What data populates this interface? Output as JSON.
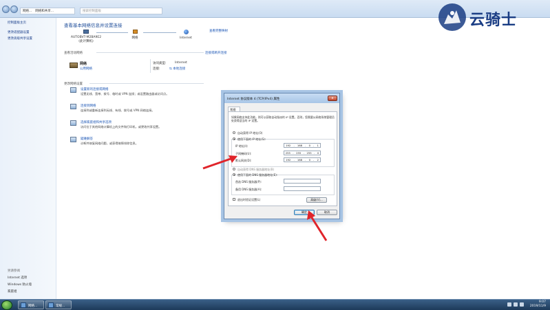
{
  "breadcrumb": [
    "网络...",
    "网络和共享..."
  ],
  "search_placeholder": "搜索控制面板",
  "left_pane": {
    "items": [
      "控制面板主页",
      "更改适配器设置",
      "更改高级共享设置"
    ],
    "see_also_head": "另请参阅",
    "see_also": [
      "Internet 选项",
      "Windows 防火墙",
      "家庭组"
    ]
  },
  "main": {
    "title": "查看基本网络信息并设置连接",
    "full_map": "查看完整映射",
    "nodes": {
      "computer": "AUTOBVT-M2BA9E2",
      "computer_sub": "(此计算机)",
      "network": "网络",
      "internet": "Internet"
    },
    "active_label": "查看活动网络",
    "connect_disconnect": "连接或断开连接",
    "network_name": "网络",
    "network_type": "公用网络",
    "access_type_label": "访问类型:",
    "access_type_value": "Internet",
    "connections_label": "连接:",
    "connections_value": "本地连接",
    "change_label": "更改网络设置",
    "tasks": [
      {
        "title": "设置新的连接或网络",
        "desc": "设置无线、宽带、拨号、临时或 VPN 连接；或设置路由器或访问点。"
      },
      {
        "title": "连接到网络",
        "desc": "连接到或重新连接到无线、有线、拨号或 VPN 网络连接。"
      },
      {
        "title": "选择家庭组和共享选项",
        "desc": "访问位于其他网络计算机上的文件和打印机，或更改共享设置。"
      },
      {
        "title": "疑难解答",
        "desc": "诊断并修复网络问题，或获得故障排除信息。"
      }
    ]
  },
  "dialog": {
    "title": "Internet 协议版本 4 (TCP/IPv4) 属性",
    "close": "x",
    "tab": "常规",
    "desc": "如果网络支持此功能，则可以获取自动指派的 IP 设置。否则，您需要从网络系统管理员处获得适当的 IP 设置。",
    "auto_ip": "自动获得 IP 地址(O)",
    "use_ip": "使用下面的 IP 地址(S):",
    "ip_label": "IP 地址(I):",
    "ip_value": [
      "192",
      "168",
      "0",
      "1"
    ],
    "mask_label": "子网掩码(U):",
    "mask_value": [
      "255",
      "255",
      "255",
      "0"
    ],
    "gateway_label": "默认网关(D):",
    "gateway_value": [
      "192",
      "168",
      "0",
      "2"
    ],
    "auto_dns": "自动获得 DNS 服务器地址(B)",
    "use_dns": "使用下面的 DNS 服务器地址(E):",
    "dns_pref_label": "首选 DNS 服务器(P):",
    "dns_alt_label": "备用 DNS 服务器(A):",
    "validate_label": "退出时验证设置(L)",
    "advanced": "高级(V)...",
    "ok": "确定",
    "cancel": "取消"
  },
  "logo": {
    "text": "云骑士"
  },
  "taskbar": {
    "items": [
      "网络...",
      "常规..."
    ],
    "time": "9:07",
    "date": "2019/11/9"
  },
  "colors": {
    "link": "#1a55b5",
    "title": "#1f4e9a",
    "arrow": "#e0242a",
    "logo": "#1a3d84"
  }
}
